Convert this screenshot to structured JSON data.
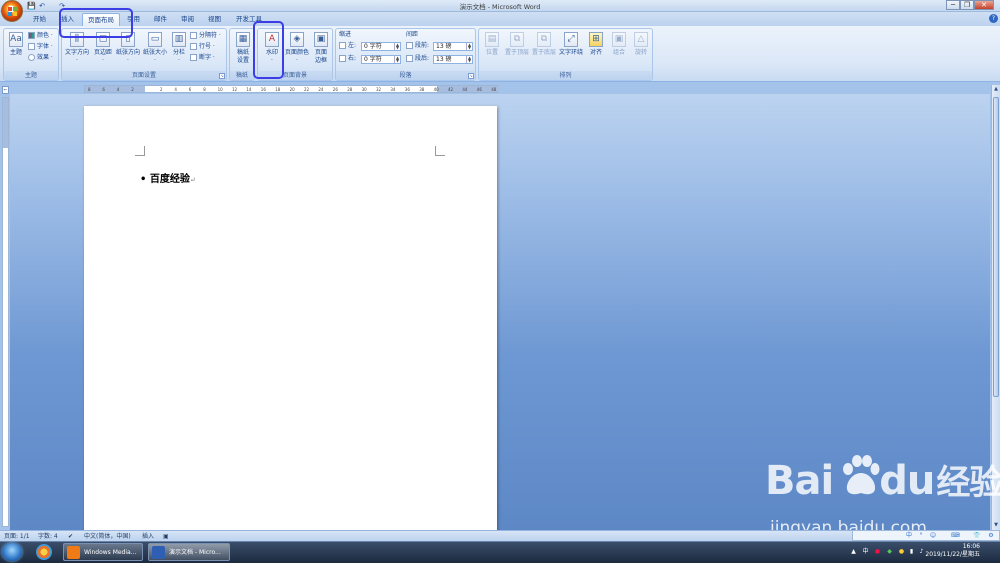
{
  "window": {
    "title": "演示文档 - Microsoft Word",
    "minimize": "─",
    "maximize": "❐",
    "close": "✕"
  },
  "quick_access": {
    "save": "💾",
    "undo": "↶",
    "redo": "↷"
  },
  "tabs": [
    {
      "label": "开始"
    },
    {
      "label": "插入"
    },
    {
      "label": "页面布局",
      "active": true
    },
    {
      "label": "引用"
    },
    {
      "label": "邮件"
    },
    {
      "label": "审阅"
    },
    {
      "label": "视图"
    },
    {
      "label": "开发工具"
    }
  ],
  "help": "?",
  "ribbon": {
    "theme": {
      "label": "主题",
      "theme_btn": "主题",
      "colors": "颜色 ·",
      "fonts": "字体 ·",
      "effects": "效果 ·"
    },
    "page_setup": {
      "label": "页面设置",
      "text_direction": "文字方向",
      "margins": "页边距",
      "orientation": "纸张方向",
      "size": "纸张大小",
      "columns": "分栏",
      "breaks": "分隔符 ·",
      "line_numbers": "行号 ·",
      "hyphenation": "断字 ·"
    },
    "manuscript": {
      "label": "稿纸",
      "settings_line1": "稿纸",
      "settings_line2": "设置"
    },
    "page_background": {
      "label": "页面背景",
      "watermark": "水印",
      "page_color": "页面颜色",
      "borders_line1": "页面",
      "borders_line2": "边框"
    },
    "paragraph": {
      "label": "段落",
      "indent_title": "缩进",
      "indent_left_label": "左:",
      "indent_left_value": "0 字符",
      "indent_right_label": "右:",
      "indent_right_value": "0 字符",
      "spacing_title": "间距",
      "before_label": "段前:",
      "before_value": "13 磅",
      "after_label": "段后:",
      "after_value": "13 磅"
    },
    "arrange": {
      "label": "排列",
      "position": "位置",
      "bring_front": "置于顶层",
      "send_back": "置于底层",
      "text_wrap": "文字环绕",
      "align": "对齐",
      "group": "组合",
      "rotate": "旋转"
    }
  },
  "ruler": {
    "ticks": [
      "8",
      "6",
      "4",
      "2",
      "",
      "2",
      "4",
      "6",
      "8",
      "10",
      "12",
      "14",
      "16",
      "18",
      "20",
      "22",
      "24",
      "26",
      "28",
      "30",
      "32",
      "34",
      "36",
      "38",
      "40",
      "42",
      "44",
      "46",
      "48"
    ]
  },
  "document": {
    "text": "百度经验",
    "bullet": "•",
    "para_mark": "↵"
  },
  "statusbar": {
    "page": "页面: 1/1",
    "words": "字数: 4",
    "language": "中文(简体，中国)",
    "mode": "插入"
  },
  "taskbar": {
    "apps": [
      {
        "label": "Windows Media...",
        "color": "#f07a16"
      },
      {
        "label": "演示文档 - Micro...",
        "color": "#2e5fb3"
      }
    ],
    "time": "16:06",
    "date": "2019/11/22/星期五"
  },
  "watermark": {
    "logo_left": "Bai",
    "logo_right": "du",
    "logo_cn": "经验",
    "url": "jingyan.baidu.com"
  },
  "ime": {
    "chars": [
      "中",
      "°",
      "☺",
      "⌨",
      "👕",
      "⚙"
    ]
  },
  "colors": {
    "accent": "#3c3de6",
    "ribbon_text": "#15428b"
  }
}
